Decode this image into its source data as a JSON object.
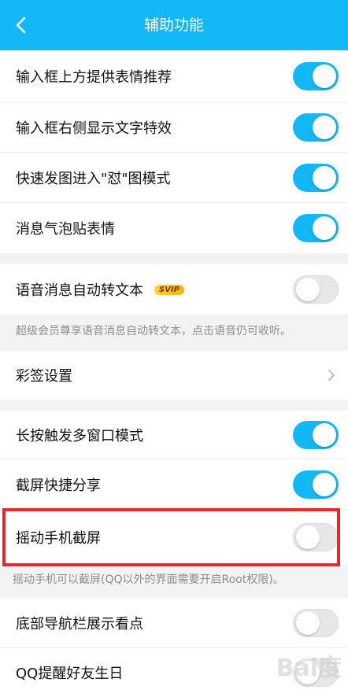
{
  "header": {
    "title": "辅助功能"
  },
  "group1": [
    {
      "label": "输入框上方提供表情推荐",
      "on": true
    },
    {
      "label": "输入框右侧显示文字特效",
      "on": true
    },
    {
      "label": "快速发图进入\"怼\"图模式",
      "on": true
    },
    {
      "label": "消息气泡贴表情",
      "on": true
    }
  ],
  "voice": {
    "label": "语音消息自动转文本",
    "badge": "SVIP",
    "on": false,
    "note": "超级会员尊享语音消息自动转文本，点击语音仍可收听。"
  },
  "signature": {
    "label": "彩签设置"
  },
  "group3": [
    {
      "label": "长按触发多窗口模式",
      "on": true
    },
    {
      "label": "截屏快捷分享",
      "on": true
    },
    {
      "label": "摇动手机截屏",
      "on": false
    }
  ],
  "shake_note": "摇动手机可以截屏(QQ以外的界面需要开启Root权限)。",
  "group4": [
    {
      "label": "底部导航栏展示看点",
      "on": false
    },
    {
      "label": "QQ提醒好友生日",
      "on": false
    }
  ],
  "watermark": "Bai度",
  "colors": {
    "accent": "#12b7f5",
    "highlight": "#e8262c"
  }
}
